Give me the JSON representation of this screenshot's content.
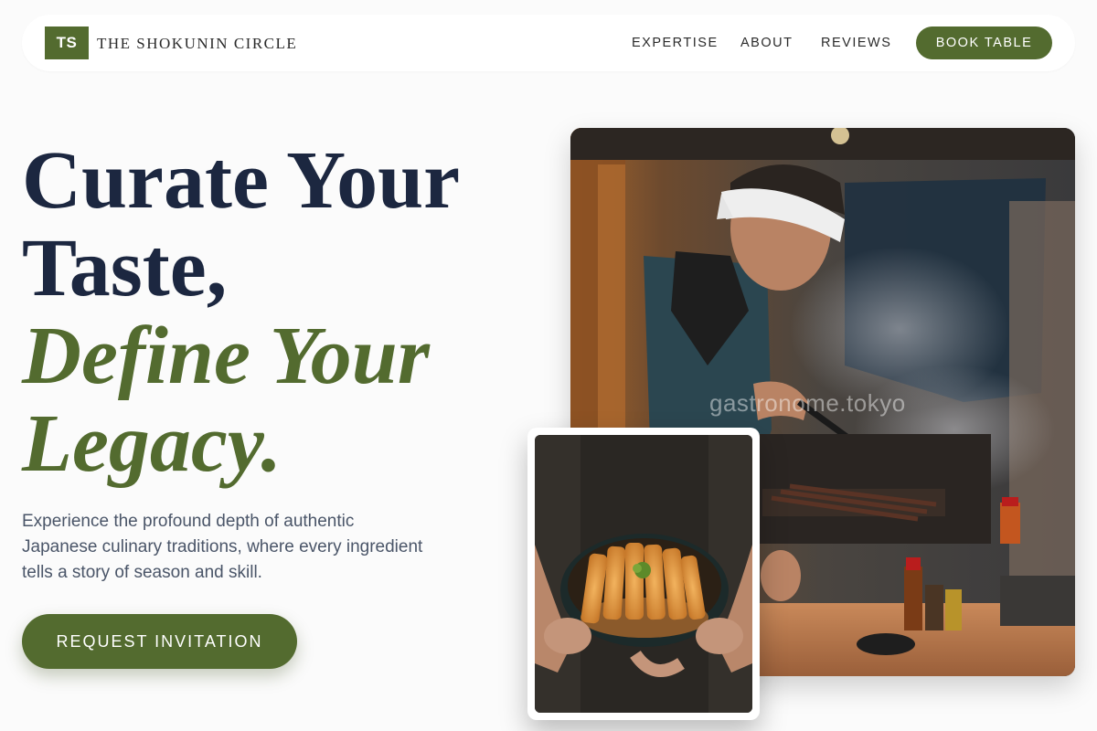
{
  "nav": {
    "logo_initials": "TS",
    "brand_name": "THE SHOKUNIN CIRCLE",
    "links": [
      "EXPERTISE",
      "ABOUT",
      "REVIEWS"
    ],
    "book_button": "BOOK TABLE"
  },
  "hero": {
    "headline_line1": "Curate Your",
    "headline_line2": "Taste,",
    "headline_accent_line1": "Define Your",
    "headline_accent_line2": "Legacy.",
    "subtext": "Experience the profound depth of authentic Japanese culinary traditions, where every ingredient tells a story of season and skill.",
    "cta_label": "REQUEST INVITATION"
  },
  "images": {
    "main_watermark": "gastronome.tokyo"
  },
  "colors": {
    "accent": "#536b2f",
    "headline": "#1c2740",
    "body_text": "#4a5568",
    "background": "#fbfbfb"
  }
}
